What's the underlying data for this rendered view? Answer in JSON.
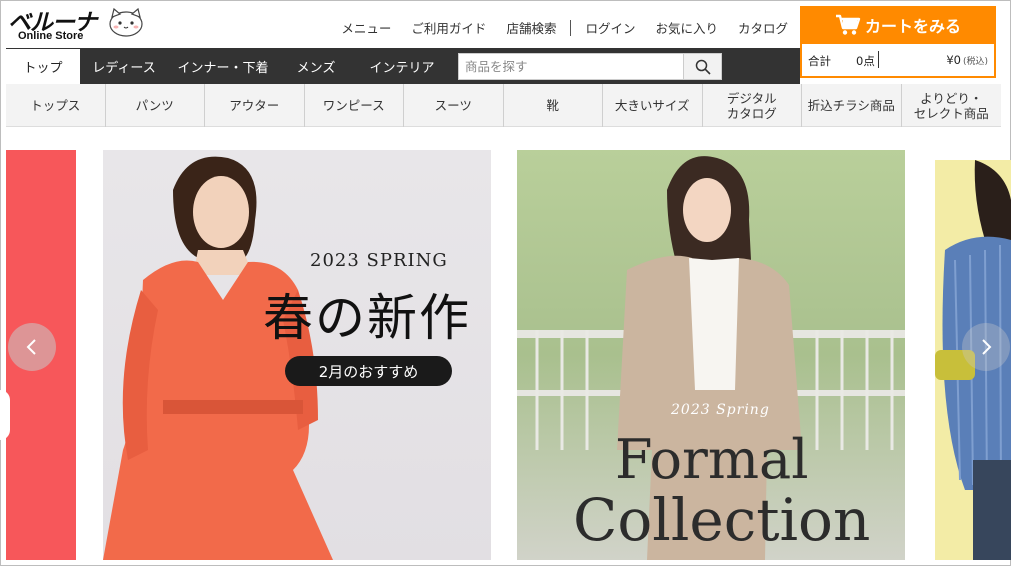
{
  "brand": {
    "logo_text": "ベルーナ",
    "sub_text": "Online Store"
  },
  "topnav": {
    "menu": "メニュー",
    "guide": "ご利用ガイド",
    "store_search": "店舗検索",
    "login": "ログイン",
    "favorites": "お気に入り",
    "catalog": "カタログ"
  },
  "cart": {
    "button_label": "カートをみる",
    "total_label": "合計",
    "count": "0点",
    "amount": "¥0",
    "tax_note": "(税込)"
  },
  "mainnav": {
    "items": [
      "トップ",
      "レディース",
      "インナー・下着",
      "メンズ",
      "インテリア"
    ]
  },
  "search": {
    "placeholder": "商品を探す"
  },
  "categories": [
    "トップス",
    "パンツ",
    "アウター",
    "ワンピース",
    "スーツ",
    "靴",
    "大きいサイズ",
    "デジタル\nカタログ",
    "折込チラシ商品",
    "よりどり・\nセレクト商品"
  ],
  "banner": {
    "slide1": {
      "year": "2023 SPRING",
      "title": "春の新作",
      "pill": "2月のおすすめ"
    },
    "slide2": {
      "spring": "2023 Spring",
      "line1": "Formal",
      "line2": "Collection"
    }
  },
  "colors": {
    "accent": "#ff8a00",
    "nav_bg": "#333333",
    "slide_red": "#f7575a"
  }
}
